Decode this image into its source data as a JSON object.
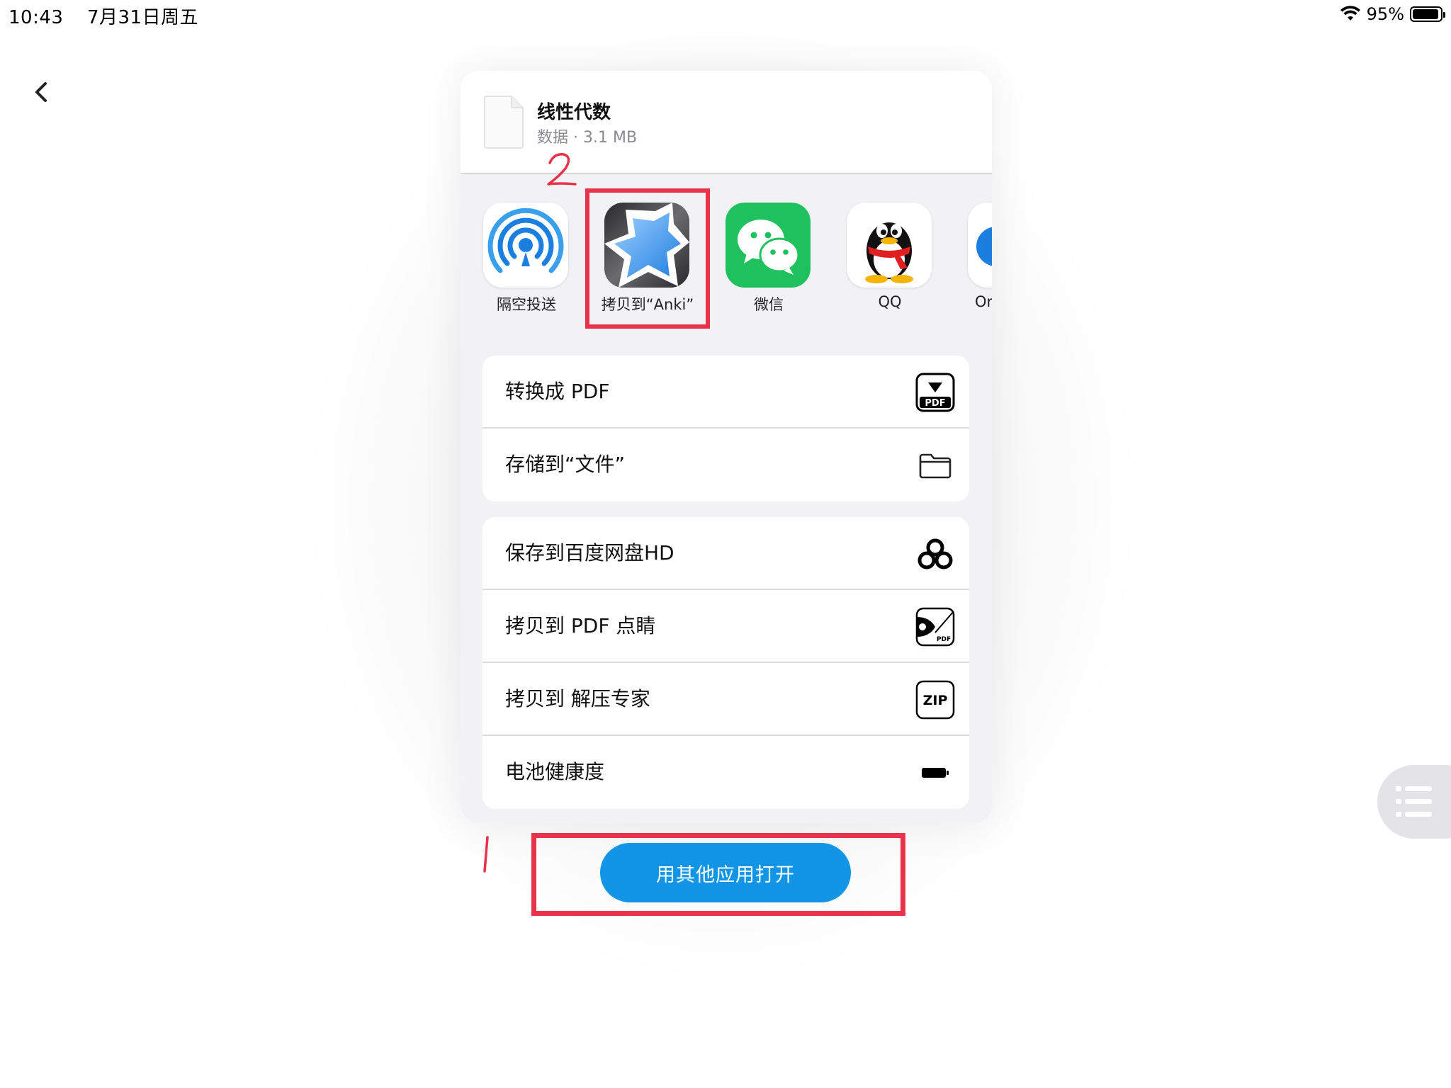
{
  "status": {
    "time": "10:43",
    "date": "7月31日周五",
    "battery": "95%",
    "battery_level": 0.95
  },
  "file": {
    "title": "线性代数",
    "meta": "数据 · 3.1 MB"
  },
  "apps": [
    {
      "label": "隔空投送",
      "icon": "airdrop-icon"
    },
    {
      "label": "拷贝到“Anki”",
      "icon": "anki-icon"
    },
    {
      "label": "微信",
      "icon": "wechat-icon"
    },
    {
      "label": "QQ",
      "icon": "qq-icon"
    },
    {
      "label": "Or",
      "icon": "partial-app-icon"
    }
  ],
  "actions_group1": [
    {
      "label": "转换成 PDF",
      "icon": "pdf-convert-icon"
    },
    {
      "label": "存储到“文件”",
      "icon": "folder-icon"
    }
  ],
  "actions_group2": [
    {
      "label": "保存到百度网盘HD",
      "icon": "baidu-netdisk-icon"
    },
    {
      "label": "拷贝到 PDF 点睛",
      "icon": "pdf-eye-icon"
    },
    {
      "label": "拷贝到 解压专家",
      "icon": "zip-icon"
    },
    {
      "label": "电池健康度",
      "icon": "battery-icon"
    }
  ],
  "annotations": {
    "one": "1",
    "two": "2"
  },
  "open_button": {
    "label": "用其他应用打开"
  },
  "colors": {
    "accent": "#1295e6",
    "annotation": "#e8334a",
    "wechat": "#1fc15e"
  }
}
